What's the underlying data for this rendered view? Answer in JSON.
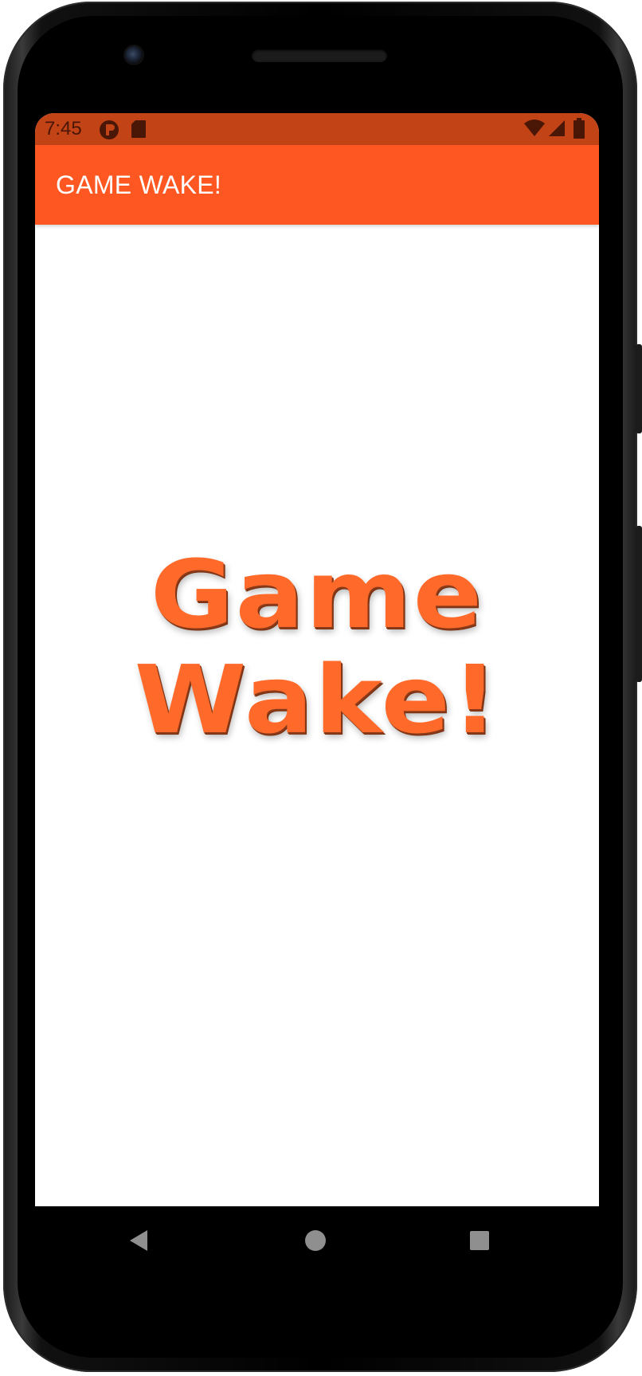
{
  "status_bar": {
    "time": "7:45",
    "icons": [
      "notification-p-icon",
      "sd-card-icon",
      "wifi-icon",
      "signal-icon",
      "battery-icon"
    ]
  },
  "app_bar": {
    "title": "GAME WAKE!"
  },
  "splash": {
    "logo_line_1": "Game",
    "logo_line_2": "Wake!"
  },
  "nav_bar": {
    "buttons": [
      "back-icon",
      "home-icon",
      "recents-icon"
    ]
  },
  "colors": {
    "status_bar": "#c14316",
    "app_bar": "#ff5722",
    "logo": "#ff6a2b",
    "screen_bg": "#ffffff"
  }
}
